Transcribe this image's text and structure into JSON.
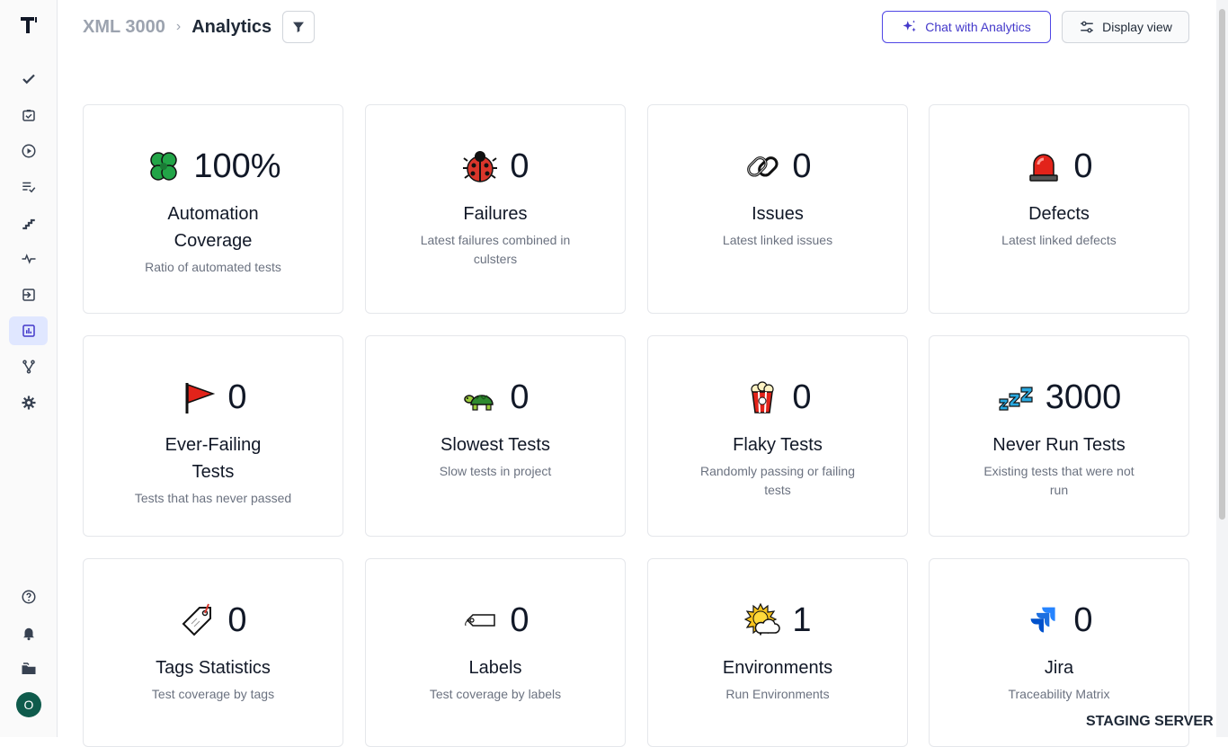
{
  "breadcrumb": {
    "root": "XML 3000",
    "separator": "›",
    "current": "Analytics"
  },
  "toolbar": {
    "chat_label": "Chat with Analytics",
    "display_label": "Display view"
  },
  "user": {
    "initial": "O"
  },
  "footer": {
    "staging": "STAGING SERVER"
  },
  "cards": [
    {
      "value": "100%",
      "title": "Automation Coverage",
      "desc": "Ratio of automated tests",
      "icon": "clover-icon"
    },
    {
      "value": "0",
      "title": "Failures",
      "desc": "Latest failures combined in culsters",
      "icon": "ladybug-icon"
    },
    {
      "value": "0",
      "title": "Issues",
      "desc": "Latest linked issues",
      "icon": "chain-link-icon"
    },
    {
      "value": "0",
      "title": "Defects",
      "desc": "Latest linked defects",
      "icon": "siren-icon"
    },
    {
      "value": "0",
      "title": "Ever-Failing Tests",
      "desc": "Tests that has never passed",
      "icon": "red-flag-icon"
    },
    {
      "value": "0",
      "title": "Slowest Tests",
      "desc": "Slow tests in project",
      "icon": "turtle-icon"
    },
    {
      "value": "0",
      "title": "Flaky Tests",
      "desc": "Randomly passing or failing tests",
      "icon": "popcorn-icon"
    },
    {
      "value": "3000",
      "title": "Never Run Tests",
      "desc": "Existing tests that were not run",
      "icon": "zzz-icon"
    },
    {
      "value": "0",
      "title": "Tags Statistics",
      "desc": "Test coverage by tags",
      "icon": "tag-icon"
    },
    {
      "value": "0",
      "title": "Labels",
      "desc": "Test coverage by labels",
      "icon": "label-icon"
    },
    {
      "value": "1",
      "title": "Environments",
      "desc": "Run Environments",
      "icon": "sun-cloud-icon"
    },
    {
      "value": "0",
      "title": "Jira",
      "desc": "Traceability Matrix",
      "icon": "jira-icon"
    }
  ],
  "colors": {
    "accent": "#4338ca",
    "active_nav": "#e0e7ff",
    "avatar": "#0f5b4c"
  }
}
